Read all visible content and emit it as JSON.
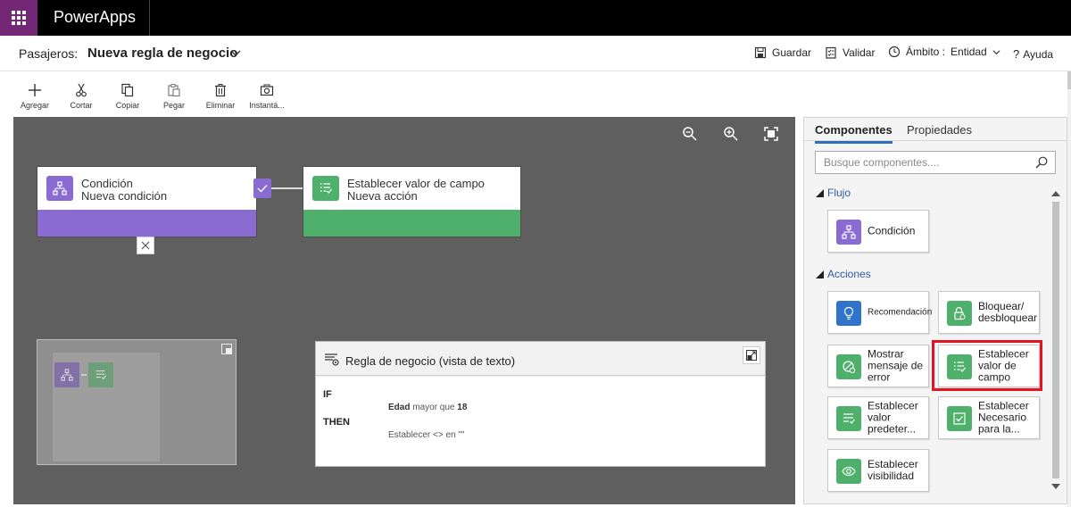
{
  "app": {
    "name": "PowerApps"
  },
  "header": {
    "entity_label": "Pasajeros:",
    "rule_name": "Nueva regla de negocio",
    "save_label": "Guardar",
    "validate_label": "Validar",
    "scope_label": "Ámbito :",
    "scope_value": "Entidad",
    "help_label": "Ayuda"
  },
  "ribbon": {
    "add": "Agregar",
    "cut": "Cortar",
    "copy": "Copiar",
    "paste": "Pegar",
    "delete": "Eliminar",
    "snapshot": "Instantá..."
  },
  "canvas": {
    "condition_node": {
      "title": "Condición",
      "subtitle": "Nueva condición",
      "color": "#8a6bd1"
    },
    "action_node": {
      "title": "Establecer valor de campo",
      "subtitle": "Nueva acción",
      "color": "#4fb06b"
    },
    "text_view": {
      "title": "Regla de negocio (vista de texto)",
      "if_keyword": "IF",
      "then_keyword": "THEN",
      "condition_field": "Edad",
      "condition_operator": "mayor que",
      "condition_value": "18",
      "action_text": "Establecer <> en \"\""
    }
  },
  "panel": {
    "tabs": [
      {
        "label": "Componentes",
        "active": true
      },
      {
        "label": "Propiedades",
        "active": false
      }
    ],
    "search_placeholder": "Busque componentes....",
    "sections": {
      "flow": "Flujo",
      "actions": "Acciones"
    },
    "flow_items": [
      {
        "label": "Condición",
        "icon": "flow-icon",
        "color": "#8a6bd1"
      }
    ],
    "action_items": [
      {
        "label": "Recomendación",
        "icon": "lightbulb-icon",
        "color": "#2f74c9"
      },
      {
        "label": "Bloquear/ desbloquear",
        "icon": "lock-icon",
        "color": "#4fb06b"
      },
      {
        "label": "Mostrar mensaje de error",
        "icon": "error-icon",
        "color": "#4fb06b"
      },
      {
        "label": "Establecer valor de campo",
        "icon": "set-field-icon",
        "color": "#4fb06b",
        "highlighted": true
      },
      {
        "label": "Establecer valor predeter...",
        "icon": "set-default-icon",
        "color": "#4fb06b"
      },
      {
        "label": "Establecer Necesario para la...",
        "icon": "required-icon",
        "color": "#4fb06b"
      },
      {
        "label": "Establecer visibilidad",
        "icon": "eye-icon",
        "color": "#4fb06b"
      }
    ],
    "highlight_color": "#e0151f"
  }
}
